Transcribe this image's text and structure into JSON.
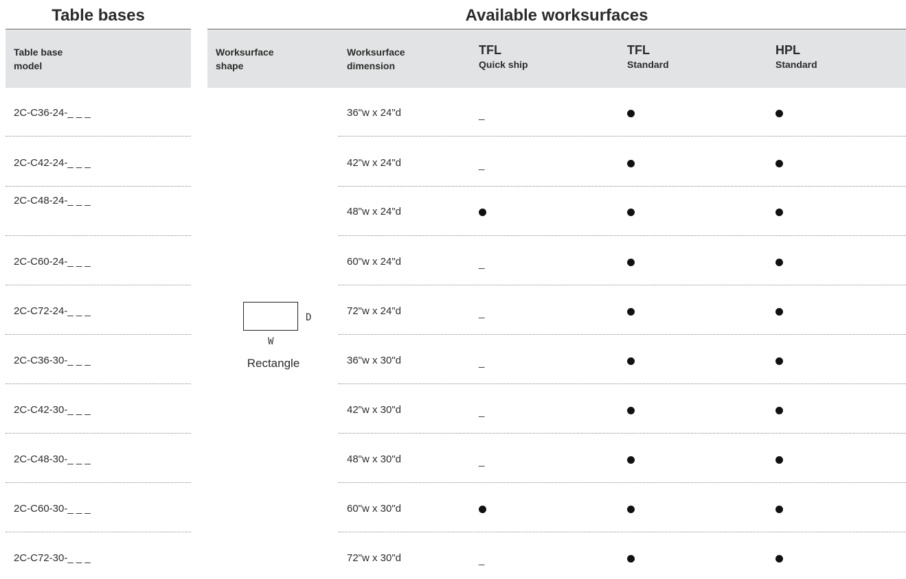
{
  "sections": {
    "left_title": "Table bases",
    "right_title": "Available worksurfaces"
  },
  "headers": {
    "model": [
      "Table base",
      "model"
    ],
    "shape": [
      "Worksurface",
      "shape"
    ],
    "dimension": [
      "Worksurface",
      "dimension"
    ],
    "tfl_quick": [
      "TFL",
      "Quick ship"
    ],
    "tfl_std": [
      "TFL",
      "Standard"
    ],
    "hpl_std": [
      "HPL",
      "Standard"
    ]
  },
  "shape": {
    "name": "Rectangle",
    "w_label": "W",
    "d_label": "D"
  },
  "rows": [
    {
      "model": "2C-C36-24-_ _ _",
      "dimension": "36\"w x 24\"d",
      "tfl_quick": false,
      "tfl_std": true,
      "hpl_std": true
    },
    {
      "model": "2C-C42-24-_ _ _",
      "dimension": "42\"w x 24\"d",
      "tfl_quick": false,
      "tfl_std": true,
      "hpl_std": true
    },
    {
      "model": "2C-C48-24-_ _ _",
      "dimension": "48\"w x 24\"d",
      "tfl_quick": true,
      "tfl_std": true,
      "hpl_std": true
    },
    {
      "model": "2C-C60-24-_ _ _",
      "dimension": "60\"w x 24\"d",
      "tfl_quick": false,
      "tfl_std": true,
      "hpl_std": true
    },
    {
      "model": "2C-C72-24-_ _ _",
      "dimension": "72\"w x 24\"d",
      "tfl_quick": false,
      "tfl_std": true,
      "hpl_std": true
    },
    {
      "model": "2C-C36-30-_ _ _",
      "dimension": "36\"w x 30\"d",
      "tfl_quick": false,
      "tfl_std": true,
      "hpl_std": true
    },
    {
      "model": "2C-C42-30-_ _ _",
      "dimension": "42\"w x 30\"d",
      "tfl_quick": false,
      "tfl_std": true,
      "hpl_std": true
    },
    {
      "model": "2C-C48-30-_ _ _",
      "dimension": "48\"w x 30\"d",
      "tfl_quick": false,
      "tfl_std": true,
      "hpl_std": true
    },
    {
      "model": "2C-C60-30-_ _ _",
      "dimension": "60\"w x 30\"d",
      "tfl_quick": true,
      "tfl_std": true,
      "hpl_std": true
    },
    {
      "model": "2C-C72-30-_ _ _",
      "dimension": "72\"w x 30\"d",
      "tfl_quick": false,
      "tfl_std": true,
      "hpl_std": true
    }
  ],
  "symbols": {
    "available": "●",
    "unavailable": "_"
  }
}
